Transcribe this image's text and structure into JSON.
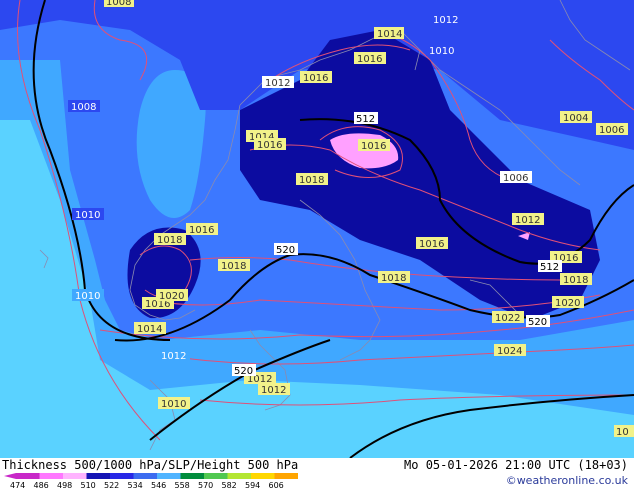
{
  "header": {
    "title": "Thickness 500/1000 hPa/SLP/Height 500 hPa",
    "timestamp": "Mo 05-01-2026 21:00 UTC (18+03)",
    "credit": "©weatheronline.co.uk"
  },
  "scale": {
    "ticks": [
      "474",
      "486",
      "498",
      "510",
      "522",
      "534",
      "546",
      "558",
      "570",
      "582",
      "594",
      "606"
    ],
    "colors": [
      "#c828c8",
      "#ff78ff",
      "#ffb4ff",
      "#1414b4",
      "#2828e6",
      "#3c6cf0",
      "#50b4ff",
      "#008c3c",
      "#50c850",
      "#b4e632",
      "#ffd700",
      "#ffa500"
    ]
  },
  "colors": {
    "band_498": "#ffa0ff",
    "band_504": "#0c0ca0",
    "band_510": "#1e1ed2",
    "band_516": "#2c48f0",
    "band_522": "#3c78ff",
    "band_528": "#40a8ff",
    "band_534": "#5ad2ff",
    "isobar": "#e05078",
    "height_contour": "#000000",
    "coastline": "#8a8ab0",
    "label_bg": "#f2f28a"
  },
  "pressure_labels": [
    "1008",
    "1012",
    "1014",
    "1010",
    "1008",
    "1012",
    "1016",
    "1016",
    "1004",
    "1006",
    "1014",
    "1016",
    "1016",
    "1018",
    "1006",
    "1010",
    "1016",
    "1018",
    "1012",
    "1018",
    "1016",
    "1016",
    "1018",
    "1018",
    "1010",
    "1016",
    "1020",
    "1018",
    "1020",
    "1014",
    "1022",
    "1012",
    "1024",
    "1012",
    "1012",
    "1010",
    "10"
  ],
  "height_labels": [
    "512",
    "520",
    "512",
    "520",
    "520"
  ]
}
